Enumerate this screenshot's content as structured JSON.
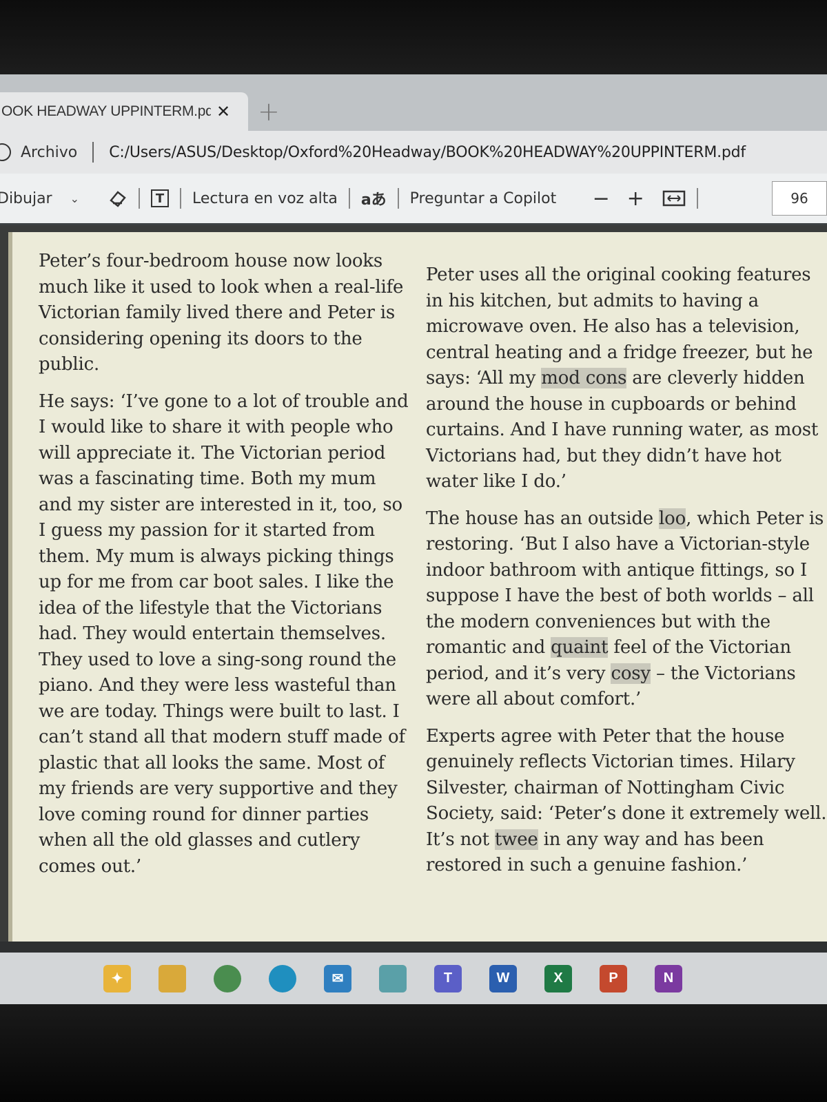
{
  "tab": {
    "title": "OOK HEADWAY UPPINTERM.pd"
  },
  "address": {
    "label": "Archivo",
    "url": "C:/Users/ASUS/Desktop/Oxford%20Headway/BOOK%20HEADWAY%20UPPINTERM.pdf"
  },
  "toolbar": {
    "draw_label": "Dibujar",
    "read_aloud_label": "Lectura en voz alta",
    "copilot_label": "Preguntar a Copilot",
    "zoom_out": "−",
    "zoom_in": "+",
    "page_number": "96"
  },
  "document": {
    "left_col": {
      "p1": "Peter’s four-bedroom house now looks much like it used to look when a real-life Victorian family lived there and Peter is considering opening its doors to the public.",
      "p2": "He says: ‘I’ve gone to a lot of trouble and I would like to share it with people who will appreciate it. The Victorian period was a fascinating time. Both my mum and my sister are interested in it, too, so I guess my passion for it started from them. My mum is always picking things up for me from car boot sales. I like the idea of the lifestyle that the Victorians had. They would entertain themselves. They used to love a sing-song round the piano. And they were less wasteful than we are today. Things were built to last. I can’t stand all that modern stuff made of plastic that all looks the same. Most of my friends are very supportive and they love coming round for dinner parties when all the old glasses and cutlery comes out.’"
    },
    "right_col": {
      "p1_a": "Peter uses all the original cooking features in his kitchen, but admits to having a microwave oven. He also has a television, central heating and a fridge freezer, but he says: ‘All my ",
      "p1_hl": "mod cons",
      "p1_b": " are cleverly hidden around the house in cupboards or behind curtains. And I have running water, as most Victorians had, but they didn’t have hot water like I do.’",
      "p2_a": "The house has an outside ",
      "p2_hl1": "loo",
      "p2_b": ", which Peter is restoring. ‘But I also have a Victorian-style indoor bathroom with antique fittings, so I suppose I have the best of both worlds – all the modern conveniences but with the romantic and ",
      "p2_hl2": "quaint",
      "p2_c": " feel of the Victorian period, and it’s very ",
      "p2_hl3": "cosy",
      "p2_d": " – the Victorians were all about comfort.’",
      "p3_a": "Experts agree with Peter that the house genuinely reflects Victorian times. Hilary Silvester, chairman of Nottingham Civic Society, said: ‘Peter’s done it extremely well. It’s not ",
      "p3_hl": "twee",
      "p3_b": " in any way and has been restored in such a genuine fashion.’"
    }
  },
  "taskbar": {
    "apps": [
      {
        "name": "copilot-icon",
        "color": "#e8b43a"
      },
      {
        "name": "file-explorer-icon",
        "color": "#d9a93a"
      },
      {
        "name": "chrome-icon",
        "color": "#4a8d4f"
      },
      {
        "name": "edge-icon",
        "color": "#1f8fbf"
      },
      {
        "name": "mail-icon",
        "color": "#2f7fc0"
      },
      {
        "name": "chat-icon",
        "color": "#5aa0a8"
      },
      {
        "name": "teams-icon",
        "color": "#5b5fc7"
      },
      {
        "name": "word-icon",
        "color": "#2b5faf"
      },
      {
        "name": "excel-icon",
        "color": "#1f7a45"
      },
      {
        "name": "powerpoint-icon",
        "color": "#c4492e"
      },
      {
        "name": "onenote-icon",
        "color": "#7b3aa0"
      }
    ]
  },
  "colors": {
    "page_bg": "#ecebd9",
    "highlight": "#c9c8bb",
    "text": "#2b2b2b"
  }
}
